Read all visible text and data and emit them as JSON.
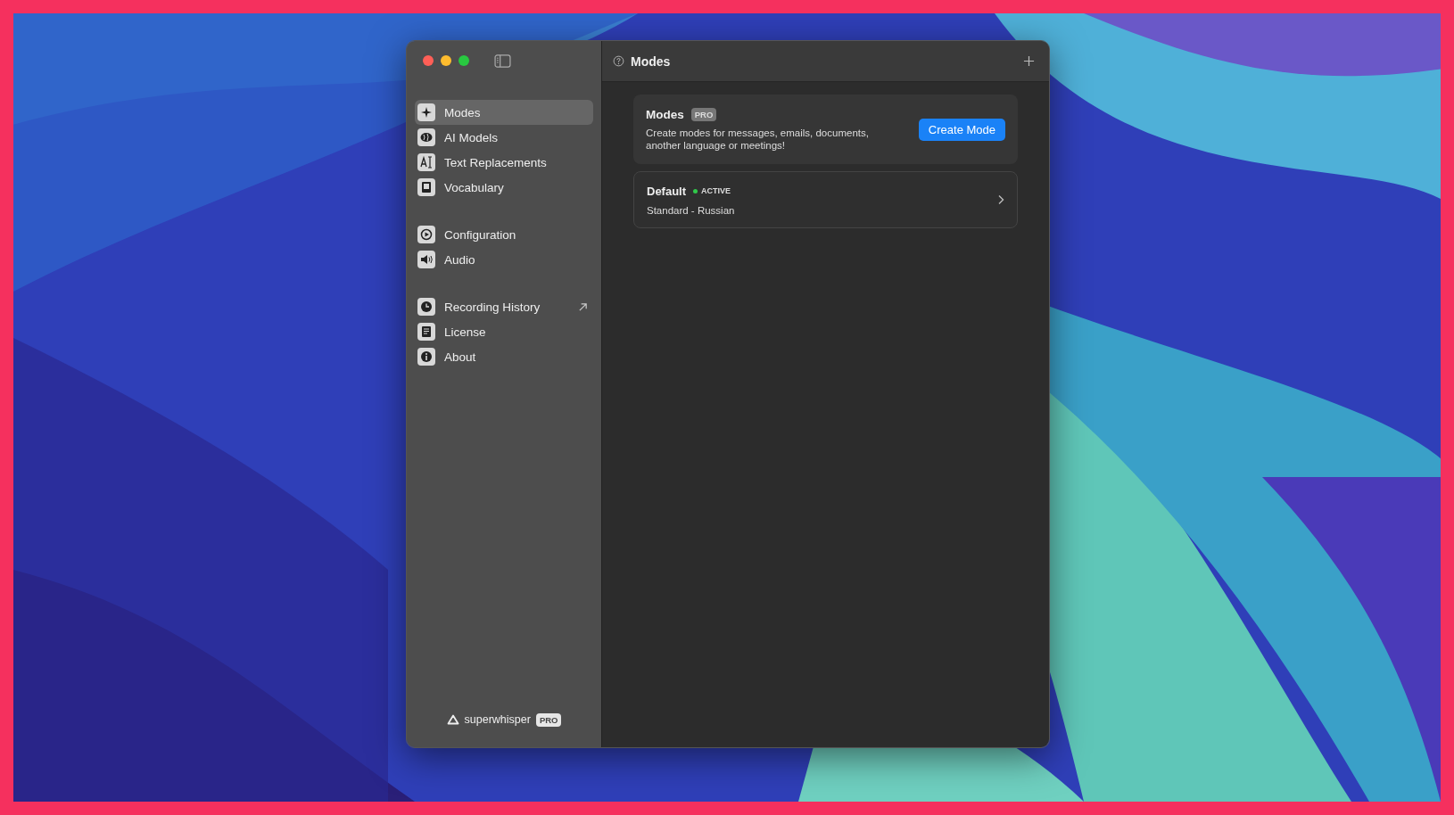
{
  "window": {
    "title": "Modes"
  },
  "sidebar": {
    "groups": [
      {
        "items": [
          {
            "label": "Modes",
            "selected": true,
            "kind": "page"
          },
          {
            "label": "AI Models",
            "selected": false,
            "kind": "page"
          },
          {
            "label": "Text Replacements",
            "selected": false,
            "kind": "page"
          },
          {
            "label": "Vocabulary",
            "selected": false,
            "kind": "page"
          }
        ]
      },
      {
        "items": [
          {
            "label": "Configuration",
            "selected": false,
            "kind": "page"
          },
          {
            "label": "Audio",
            "selected": false,
            "kind": "page"
          }
        ]
      },
      {
        "items": [
          {
            "label": "Recording History",
            "selected": false,
            "kind": "external"
          },
          {
            "label": "License",
            "selected": false,
            "kind": "page"
          },
          {
            "label": "About",
            "selected": false,
            "kind": "page"
          }
        ]
      }
    ],
    "footer": {
      "brand": "superwhisper",
      "badge": "PRO"
    }
  },
  "intro_card": {
    "title": "Modes",
    "badge": "PRO",
    "description": "Create modes for messages, emails, documents, another language or meetings!",
    "button": "Create Mode"
  },
  "modes": [
    {
      "name": "Default",
      "status": "ACTIVE",
      "active": true,
      "subtitle": "Standard - Russian"
    }
  ]
}
